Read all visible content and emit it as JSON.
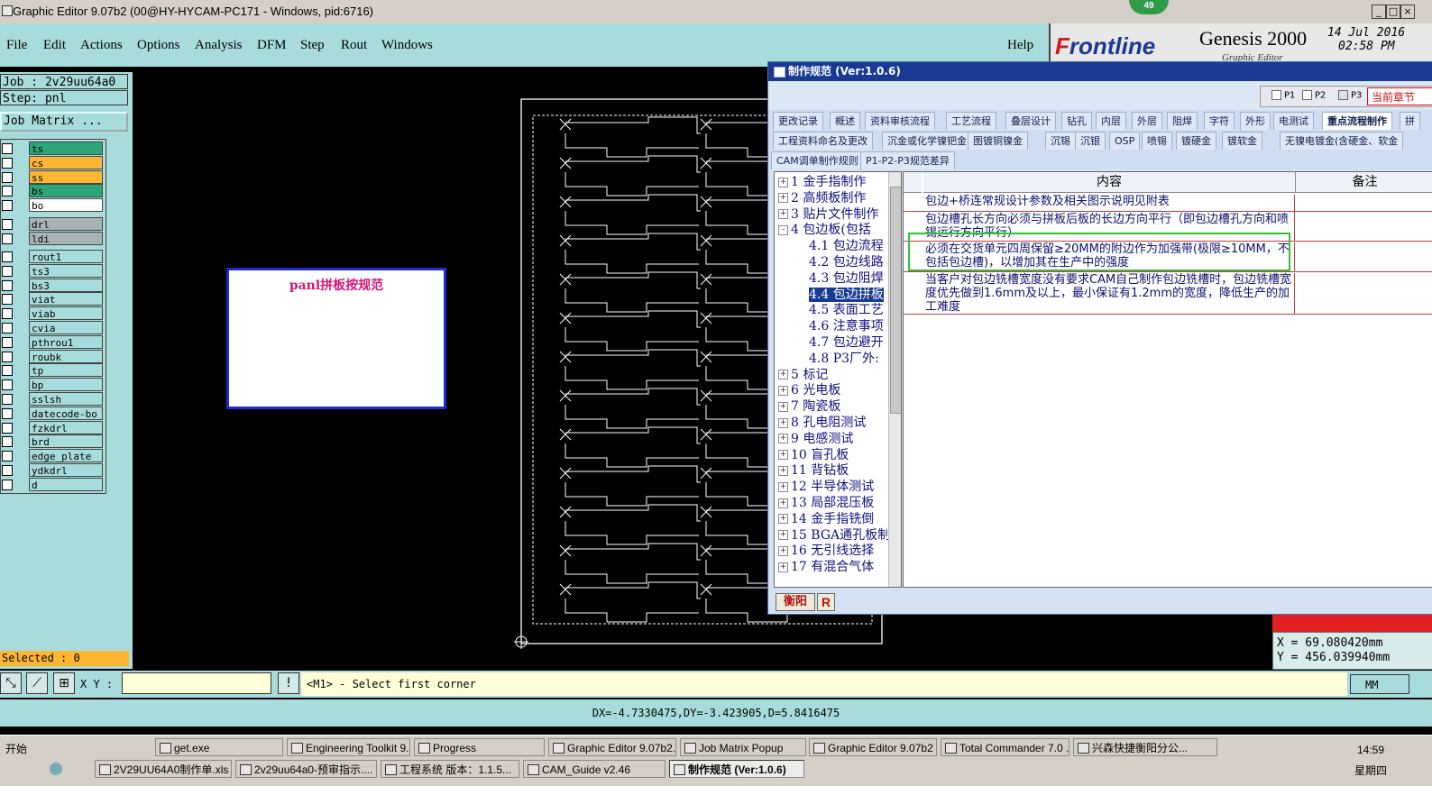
{
  "window": {
    "title": "Graphic Editor 9.07b2 (00@HY-HYCAM-PC171 - Windows, pid:6716)",
    "badge": "49"
  },
  "menu": [
    "File",
    "Edit",
    "Actions",
    "Options",
    "Analysis",
    "DFM",
    "Step",
    "Rout",
    "Windows"
  ],
  "help": "Help",
  "brand": {
    "logo": "Frontline",
    "product": "Genesis 2000",
    "subtitle": "Graphic Editor",
    "date": "14 Jul 2016",
    "time": "02:58 PM"
  },
  "job": {
    "job_line": "Job : 2v29uu64a0",
    "step_line": "Step: pnl",
    "matrix_button": "Job Matrix ..."
  },
  "layers": [
    {
      "name": "ts",
      "color": "#2ca678"
    },
    {
      "name": "cs",
      "color": "#ffb733"
    },
    {
      "name": "ss",
      "color": "#ffb733"
    },
    {
      "name": "bs",
      "color": "#2ca678"
    },
    {
      "name": "bo",
      "color": "#ffffff"
    },
    {
      "name": "drl",
      "color": "#a8b4b4"
    },
    {
      "name": "ldi",
      "color": "#a8b4b4"
    },
    {
      "name": "rout1",
      "color": "#a8dcdc"
    },
    {
      "name": "ts3",
      "color": "#a8dcdc"
    },
    {
      "name": "bs3",
      "color": "#a8dcdc"
    },
    {
      "name": "viat",
      "color": "#a8dcdc"
    },
    {
      "name": "viab",
      "color": "#a8dcdc"
    },
    {
      "name": "cvia",
      "color": "#a8dcdc"
    },
    {
      "name": "pthrou1",
      "color": "#a8dcdc"
    },
    {
      "name": "roubk",
      "color": "#a8dcdc"
    },
    {
      "name": "tp",
      "color": "#a8dcdc"
    },
    {
      "name": "bp",
      "color": "#a8dcdc"
    },
    {
      "name": "sslsh",
      "color": "#a8dcdc"
    },
    {
      "name": "datecode-bo",
      "color": "#a8dcdc"
    },
    {
      "name": "fzkdrl",
      "color": "#a8dcdc"
    },
    {
      "name": "brd",
      "color": "#a8dcdc"
    },
    {
      "name": "edge_plate",
      "color": "#a8dcdc"
    },
    {
      "name": "ydkdrl",
      "color": "#a8dcdc"
    },
    {
      "name": "d",
      "color": "#a8dcdc"
    }
  ],
  "selected": "Selected : 0",
  "canvas": {
    "panel_label": "panl拼板按规范"
  },
  "dialog": {
    "title": "制作规范 (Ver:1.0.6)",
    "filters": [
      "P1",
      "P2",
      "P3"
    ],
    "current_section": "当前章节",
    "tabs_row1": [
      "更改记录",
      "概述",
      "资料审核流程",
      "工艺流程",
      "叠层设计",
      "钻孔",
      "内层",
      "外层",
      "阻焊",
      "字符",
      "外形",
      "电测试",
      "重点流程制作",
      "拼"
    ],
    "tabs_row2": [
      "工程资料命名及更改",
      "沉金或化学镍钯金",
      "图镀铜镍金",
      "沉锡",
      "沉银",
      "OSP",
      "喷锡",
      "镀硬金",
      "镀软金",
      "无镍电镀金(含硬金、软金"
    ],
    "tabs_row3": [
      "CAM调单制作规则",
      "P1-P2-P3规范差异"
    ],
    "tree": [
      {
        "num": "1",
        "text": "金手指制作",
        "exp": "+"
      },
      {
        "num": "2",
        "text": "高频板制作",
        "exp": "+"
      },
      {
        "num": "3",
        "text": "贴片文件制作",
        "exp": "+"
      },
      {
        "num": "4",
        "text": "包边板(包括",
        "exp": "-"
      },
      {
        "num": "4.1",
        "text": "包边流程",
        "exp": ""
      },
      {
        "num": "4.2",
        "text": "包边线路",
        "exp": ""
      },
      {
        "num": "4.3",
        "text": "包边阻焊",
        "exp": ""
      },
      {
        "num": "4.4",
        "text": "包边拼板",
        "exp": "",
        "sel": true
      },
      {
        "num": "4.5",
        "text": "表面工艺",
        "exp": ""
      },
      {
        "num": "4.6",
        "text": "注意事项",
        "exp": ""
      },
      {
        "num": "4.7",
        "text": "包边避开",
        "exp": ""
      },
      {
        "num": "4.8",
        "text": "P3厂外:",
        "exp": ""
      },
      {
        "num": "5",
        "text": "标记",
        "exp": "+"
      },
      {
        "num": "6",
        "text": "光电板",
        "exp": "+"
      },
      {
        "num": "7",
        "text": "陶瓷板",
        "exp": "+"
      },
      {
        "num": "8",
        "text": "孔电阻测试",
        "exp": "+"
      },
      {
        "num": "9",
        "text": "电感测试",
        "exp": "+"
      },
      {
        "num": "10",
        "text": "盲孔板",
        "exp": "+"
      },
      {
        "num": "11",
        "text": "背钻板",
        "exp": "+"
      },
      {
        "num": "12",
        "text": "半导体测试",
        "exp": "+"
      },
      {
        "num": "13",
        "text": "局部混压板",
        "exp": "+"
      },
      {
        "num": "14",
        "text": "金手指铣倒",
        "exp": "+"
      },
      {
        "num": "15",
        "text": "BGA通孔板制",
        "exp": "+"
      },
      {
        "num": "16",
        "text": "无引线选择",
        "exp": "+"
      },
      {
        "num": "17",
        "text": "有混合气体",
        "exp": "+"
      }
    ],
    "grid_headers": {
      "content": "内容",
      "note": "备注"
    },
    "rows": [
      "包边+桥连常规设计参数及相关图示说明见附表",
      "包边槽孔长方向必须与拼板后板的长边方向平行（即包边槽孔方向和喷锡运行方向平行）",
      "必须在交货单元四周保留≥20MM的附边作为加强带(极限≥10MM，不包括包边槽)，以增加其在生产中的强度",
      "当客户对包边铣槽宽度没有要求CAM自己制作包边铣槽时，包边铣槽宽度优先做到1.6mm及以上，最小保证有1.2mm的宽度，降低生产的加工难度"
    ],
    "footer_a": "衡阳",
    "footer_b": "R"
  },
  "coords": {
    "x": "X =  69.080420mm",
    "y": "Y = 456.039940mm"
  },
  "command": {
    "xy_label": "X Y :",
    "prompt": "<M1> - Select first corner",
    "unit": "MM"
  },
  "status": {
    "dx": "DX=-4.7330475,DY=-3.423905,D=5.8416475"
  },
  "taskbar": {
    "start": "开始",
    "row1": [
      "get.exe",
      "Engineering Toolkit 9....",
      "Progress",
      "Graphic Editor 9.07b2...",
      "Job Matrix Popup",
      "Graphic Editor 9.07b2 ...",
      "Total Commander 7.0 ...",
      "兴森快捷衡阳分公..."
    ],
    "row2": [
      "2V29UU64A0制作单.xls ...",
      "2v29uu64a0-预审指示....",
      "工程系统  版本：1.1.5...",
      "CAM_Guide v2.46",
      "制作规范 (Ver:1.0.6)"
    ],
    "clock": "14:59",
    "weekday": "星期四"
  }
}
